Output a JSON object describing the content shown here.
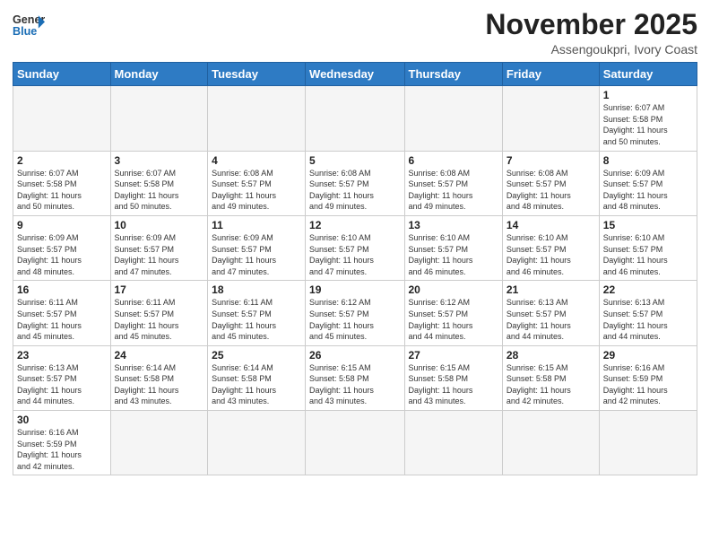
{
  "header": {
    "logo_general": "General",
    "logo_blue": "Blue",
    "month_title": "November 2025",
    "location": "Assengoukpri, Ivory Coast"
  },
  "weekdays": [
    "Sunday",
    "Monday",
    "Tuesday",
    "Wednesday",
    "Thursday",
    "Friday",
    "Saturday"
  ],
  "weeks": [
    [
      {
        "day": "",
        "info": ""
      },
      {
        "day": "",
        "info": ""
      },
      {
        "day": "",
        "info": ""
      },
      {
        "day": "",
        "info": ""
      },
      {
        "day": "",
        "info": ""
      },
      {
        "day": "",
        "info": ""
      },
      {
        "day": "1",
        "info": "Sunrise: 6:07 AM\nSunset: 5:58 PM\nDaylight: 11 hours\nand 50 minutes."
      }
    ],
    [
      {
        "day": "2",
        "info": "Sunrise: 6:07 AM\nSunset: 5:58 PM\nDaylight: 11 hours\nand 50 minutes."
      },
      {
        "day": "3",
        "info": "Sunrise: 6:07 AM\nSunset: 5:58 PM\nDaylight: 11 hours\nand 50 minutes."
      },
      {
        "day": "4",
        "info": "Sunrise: 6:08 AM\nSunset: 5:57 PM\nDaylight: 11 hours\nand 49 minutes."
      },
      {
        "day": "5",
        "info": "Sunrise: 6:08 AM\nSunset: 5:57 PM\nDaylight: 11 hours\nand 49 minutes."
      },
      {
        "day": "6",
        "info": "Sunrise: 6:08 AM\nSunset: 5:57 PM\nDaylight: 11 hours\nand 49 minutes."
      },
      {
        "day": "7",
        "info": "Sunrise: 6:08 AM\nSunset: 5:57 PM\nDaylight: 11 hours\nand 48 minutes."
      },
      {
        "day": "8",
        "info": "Sunrise: 6:09 AM\nSunset: 5:57 PM\nDaylight: 11 hours\nand 48 minutes."
      }
    ],
    [
      {
        "day": "9",
        "info": "Sunrise: 6:09 AM\nSunset: 5:57 PM\nDaylight: 11 hours\nand 48 minutes."
      },
      {
        "day": "10",
        "info": "Sunrise: 6:09 AM\nSunset: 5:57 PM\nDaylight: 11 hours\nand 47 minutes."
      },
      {
        "day": "11",
        "info": "Sunrise: 6:09 AM\nSunset: 5:57 PM\nDaylight: 11 hours\nand 47 minutes."
      },
      {
        "day": "12",
        "info": "Sunrise: 6:10 AM\nSunset: 5:57 PM\nDaylight: 11 hours\nand 47 minutes."
      },
      {
        "day": "13",
        "info": "Sunrise: 6:10 AM\nSunset: 5:57 PM\nDaylight: 11 hours\nand 46 minutes."
      },
      {
        "day": "14",
        "info": "Sunrise: 6:10 AM\nSunset: 5:57 PM\nDaylight: 11 hours\nand 46 minutes."
      },
      {
        "day": "15",
        "info": "Sunrise: 6:10 AM\nSunset: 5:57 PM\nDaylight: 11 hours\nand 46 minutes."
      }
    ],
    [
      {
        "day": "16",
        "info": "Sunrise: 6:11 AM\nSunset: 5:57 PM\nDaylight: 11 hours\nand 45 minutes."
      },
      {
        "day": "17",
        "info": "Sunrise: 6:11 AM\nSunset: 5:57 PM\nDaylight: 11 hours\nand 45 minutes."
      },
      {
        "day": "18",
        "info": "Sunrise: 6:11 AM\nSunset: 5:57 PM\nDaylight: 11 hours\nand 45 minutes."
      },
      {
        "day": "19",
        "info": "Sunrise: 6:12 AM\nSunset: 5:57 PM\nDaylight: 11 hours\nand 45 minutes."
      },
      {
        "day": "20",
        "info": "Sunrise: 6:12 AM\nSunset: 5:57 PM\nDaylight: 11 hours\nand 44 minutes."
      },
      {
        "day": "21",
        "info": "Sunrise: 6:13 AM\nSunset: 5:57 PM\nDaylight: 11 hours\nand 44 minutes."
      },
      {
        "day": "22",
        "info": "Sunrise: 6:13 AM\nSunset: 5:57 PM\nDaylight: 11 hours\nand 44 minutes."
      }
    ],
    [
      {
        "day": "23",
        "info": "Sunrise: 6:13 AM\nSunset: 5:57 PM\nDaylight: 11 hours\nand 44 minutes."
      },
      {
        "day": "24",
        "info": "Sunrise: 6:14 AM\nSunset: 5:58 PM\nDaylight: 11 hours\nand 43 minutes."
      },
      {
        "day": "25",
        "info": "Sunrise: 6:14 AM\nSunset: 5:58 PM\nDaylight: 11 hours\nand 43 minutes."
      },
      {
        "day": "26",
        "info": "Sunrise: 6:15 AM\nSunset: 5:58 PM\nDaylight: 11 hours\nand 43 minutes."
      },
      {
        "day": "27",
        "info": "Sunrise: 6:15 AM\nSunset: 5:58 PM\nDaylight: 11 hours\nand 43 minutes."
      },
      {
        "day": "28",
        "info": "Sunrise: 6:15 AM\nSunset: 5:58 PM\nDaylight: 11 hours\nand 42 minutes."
      },
      {
        "day": "29",
        "info": "Sunrise: 6:16 AM\nSunset: 5:59 PM\nDaylight: 11 hours\nand 42 minutes."
      }
    ],
    [
      {
        "day": "30",
        "info": "Sunrise: 6:16 AM\nSunset: 5:59 PM\nDaylight: 11 hours\nand 42 minutes."
      },
      {
        "day": "",
        "info": ""
      },
      {
        "day": "",
        "info": ""
      },
      {
        "day": "",
        "info": ""
      },
      {
        "day": "",
        "info": ""
      },
      {
        "day": "",
        "info": ""
      },
      {
        "day": "",
        "info": ""
      }
    ]
  ]
}
